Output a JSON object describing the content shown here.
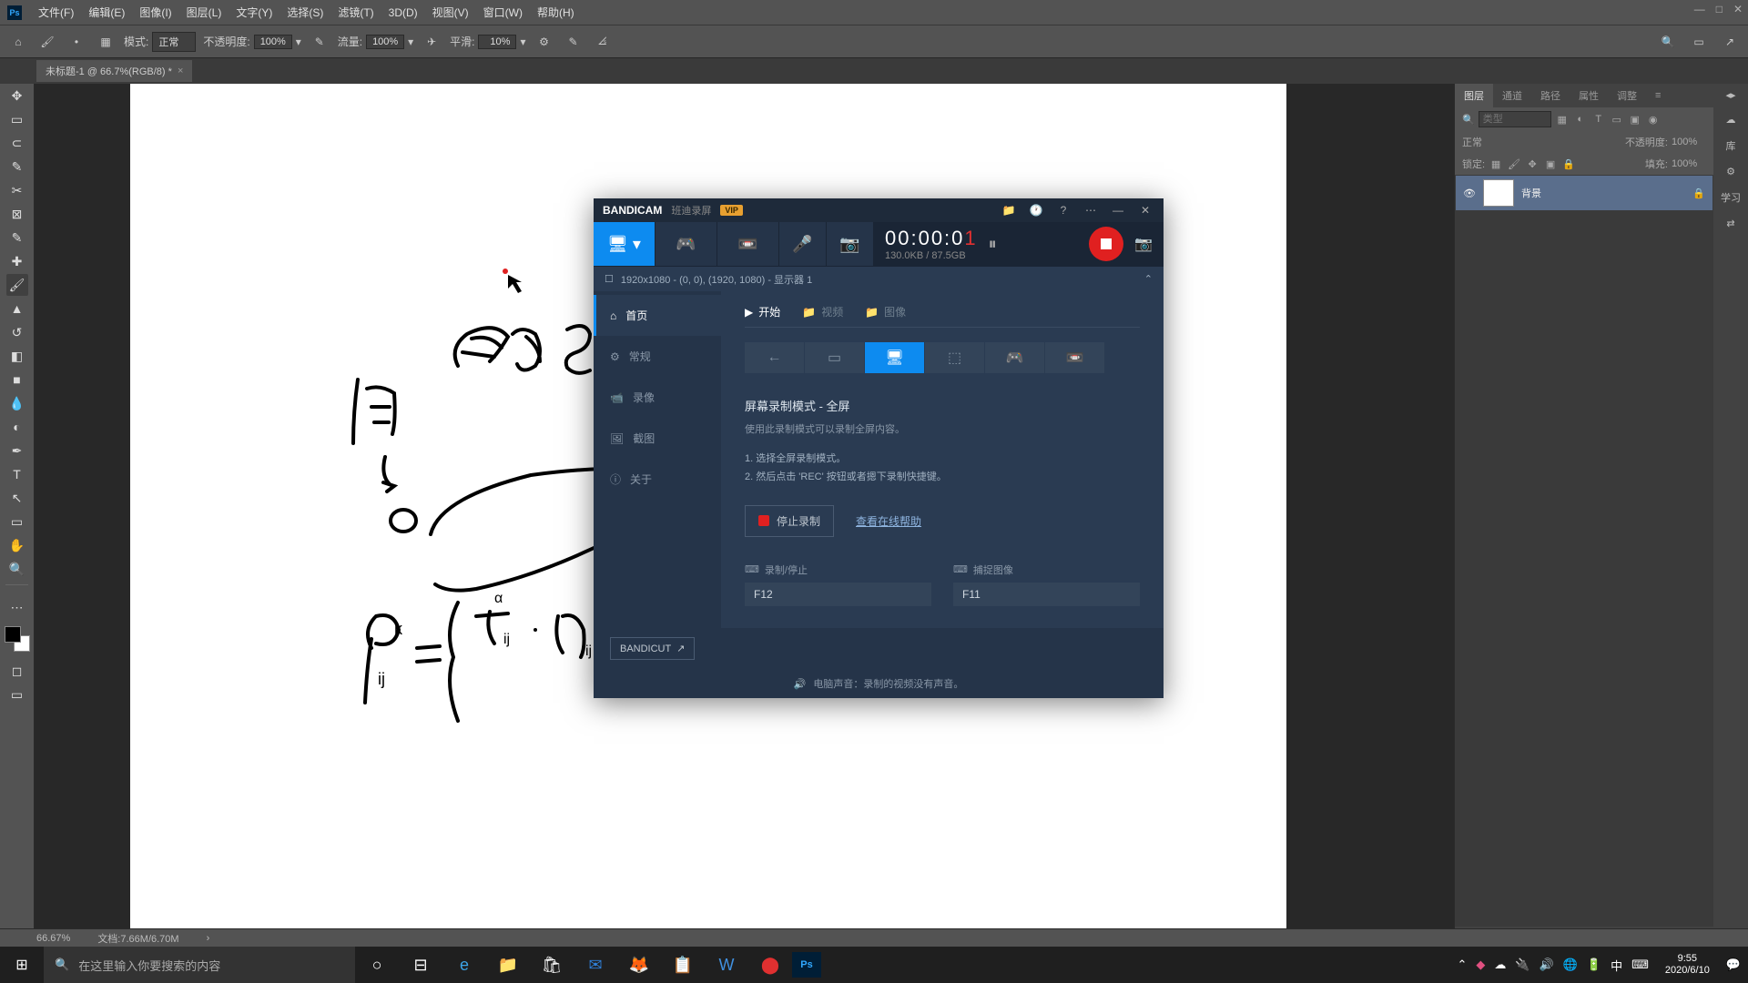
{
  "menubar": {
    "items": [
      "文件(F)",
      "编辑(E)",
      "图像(I)",
      "图层(L)",
      "文字(Y)",
      "选择(S)",
      "滤镜(T)",
      "3D(D)",
      "视图(V)",
      "窗口(W)",
      "帮助(H)"
    ]
  },
  "optbar": {
    "mode_label": "模式:",
    "mode_value": "正常",
    "opacity_label": "不透明度:",
    "opacity_value": "100%",
    "flow_label": "流量:",
    "flow_value": "100%",
    "smooth_label": "平滑:",
    "smooth_value": "10%"
  },
  "tab": {
    "title": "未标题-1 @ 66.7%(RGB/8) *"
  },
  "statusbar": {
    "zoom": "66.67%",
    "doc": "文档:7.66M/6.70M"
  },
  "rightpanel": {
    "tabs": [
      "图层",
      "通道",
      "路径",
      "属性",
      "调整"
    ],
    "search_placeholder": "类型",
    "blend": "正常",
    "opacity_label": "不透明度:",
    "opacity_value": "100%",
    "lock_label": "锁定:",
    "fill_label": "填充:",
    "fill_value": "100%",
    "layer_name": "背景"
  },
  "sidecol": {
    "items": [
      "库",
      "学习"
    ]
  },
  "bandicam": {
    "brand": "BANDICAM",
    "sub": "班迪录屏",
    "vip": "VIP",
    "time_prefix": "00:00:0",
    "time_last": "1",
    "stats": "130.0KB / 87.5GB",
    "resolution": "1920x1080 - (0, 0), (1920, 1080) - 显示器 1",
    "side": [
      "首页",
      "常规",
      "录像",
      "截图",
      "关于"
    ],
    "tabs": [
      "开始",
      "视频",
      "图像"
    ],
    "heading": "屏幕录制模式 - 全屏",
    "desc": "使用此录制模式可以录制全屏内容。",
    "step1": "1. 选择全屏录制模式。",
    "step2": "2. 然后点击 'REC' 按钮或者摁下录制快捷键。",
    "stop_label": "停止录制",
    "help_link": "查看在线帮助",
    "hk_record_label": "录制/停止",
    "hk_record_key": "F12",
    "hk_capture_label": "捕捉图像",
    "hk_capture_key": "F11",
    "bandicut": "BANDICUT",
    "footer": "电脑声音：录制的视频没有声音。"
  },
  "taskbar": {
    "search_placeholder": "在这里输入你要搜索的内容",
    "time": "9:55",
    "date": "2020/6/10"
  }
}
